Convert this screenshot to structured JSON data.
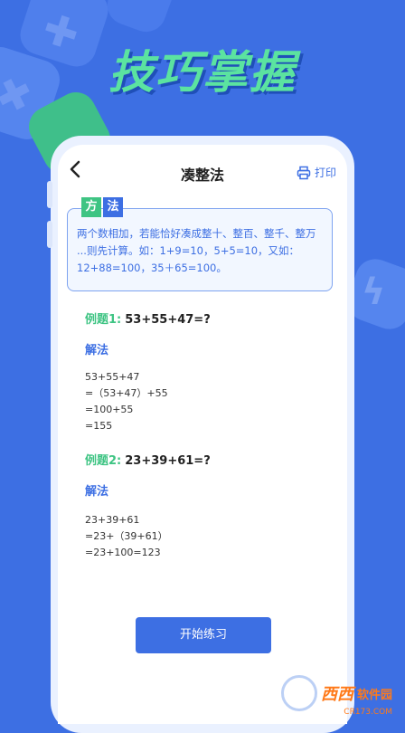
{
  "headline": "技巧掌握",
  "header": {
    "title": "凑整法",
    "print_label": "打印",
    "back_icon": "chevron-left-icon",
    "print_icon": "printer-icon"
  },
  "method": {
    "tag1": "方",
    "tag2": "法",
    "lines": [
      "两个数相加，若能恰好凑成整十、整百、整千、整万",
      "...则先计算。如：1+9=10，5+5=10，又如：",
      "12+88=100，35＋65=100。"
    ]
  },
  "examples": [
    {
      "label": "例题1:",
      "question": "53+55+47=?",
      "solution_label": "解法",
      "steps": [
        "53+55+47",
        "=（53+47）+55",
        "=100+55",
        "=155"
      ]
    },
    {
      "label": "例题2:",
      "question": "23+39+61=?",
      "solution_label": "解法",
      "steps": [
        "23+39+61",
        "=23+（39+61）",
        "=23+100=123"
      ]
    }
  ],
  "start_button": "开始练习",
  "watermark": {
    "brand": "西西",
    "sub": "软件园",
    "url": "CR173.COM"
  },
  "colors": {
    "background": "#3d6fe3",
    "accent_green": "#3ec483",
    "headline_green": "#5be3a0",
    "primary_blue": "#3d6fe3"
  }
}
